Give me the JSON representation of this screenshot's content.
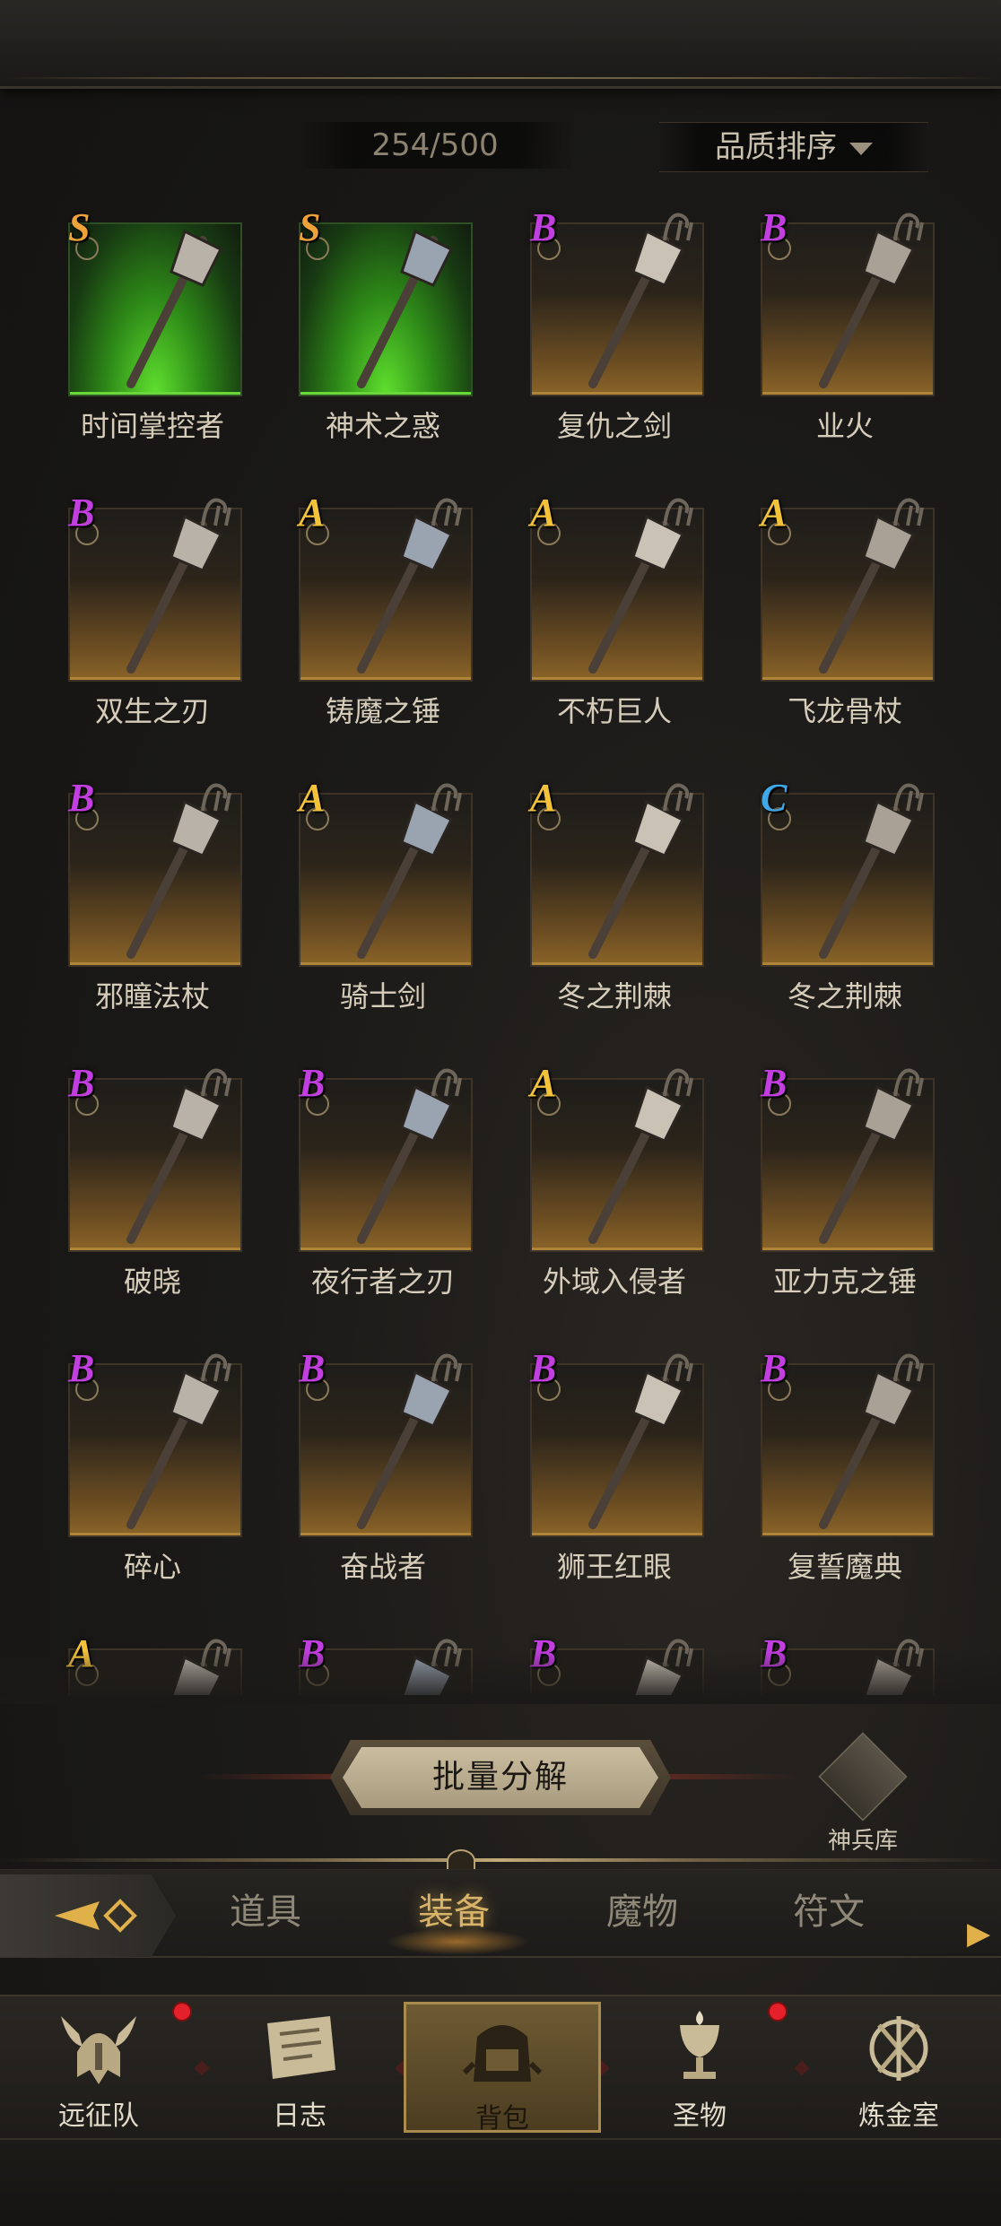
{
  "inventory": {
    "count": "254/500"
  },
  "sort": {
    "label": "品质排序"
  },
  "colors": {
    "S": "#f0a23a",
    "A": "#f2c23a",
    "B": "#c23ee0",
    "C": "#3fa8e8"
  },
  "items": [
    {
      "grade": "S",
      "name": "时间掌控者",
      "bg": "green",
      "icon": "scepter-icon"
    },
    {
      "grade": "S",
      "name": "神术之惑",
      "bg": "green",
      "icon": "star-mace-icon"
    },
    {
      "grade": "B",
      "name": "复仇之剑",
      "bg": "gold",
      "icon": "sword-icon"
    },
    {
      "grade": "B",
      "name": "业火",
      "bg": "gold",
      "icon": "fire-staff-icon"
    },
    {
      "grade": "B",
      "name": "双生之刃",
      "bg": "gold",
      "icon": "twin-blade-icon"
    },
    {
      "grade": "A",
      "name": "铸魔之锤",
      "bg": "gold",
      "icon": "hammer-icon"
    },
    {
      "grade": "A",
      "name": "不朽巨人",
      "bg": "gold",
      "icon": "great-axe-icon"
    },
    {
      "grade": "A",
      "name": "飞龙骨杖",
      "bg": "gold",
      "icon": "bone-staff-icon"
    },
    {
      "grade": "B",
      "name": "邪瞳法杖",
      "bg": "gold",
      "icon": "eye-staff-icon"
    },
    {
      "grade": "A",
      "name": "骑士剑",
      "bg": "gold",
      "icon": "knight-sword-icon"
    },
    {
      "grade": "A",
      "name": "冬之荆棘",
      "bg": "gold",
      "icon": "greatsword-icon"
    },
    {
      "grade": "C",
      "name": "冬之荆棘",
      "bg": "gold",
      "icon": "greatsword-icon"
    },
    {
      "grade": "B",
      "name": "破晓",
      "bg": "gold",
      "icon": "ornate-scepter-icon"
    },
    {
      "grade": "B",
      "name": "夜行者之刃",
      "bg": "gold",
      "icon": "dagger-icon"
    },
    {
      "grade": "A",
      "name": "外域入侵者",
      "bg": "gold",
      "icon": "axe-icon"
    },
    {
      "grade": "B",
      "name": "亚力克之锤",
      "bg": "gold",
      "icon": "warhammer-icon"
    },
    {
      "grade": "B",
      "name": "碎心",
      "bg": "gold",
      "icon": "crossbow-icon"
    },
    {
      "grade": "B",
      "name": "奋战者",
      "bg": "gold",
      "icon": "shield-axe-icon"
    },
    {
      "grade": "B",
      "name": "狮王红眼",
      "bg": "gold",
      "icon": "wand-icon"
    },
    {
      "grade": "B",
      "name": "复誓魔典",
      "bg": "gold",
      "icon": "tome-icon"
    },
    {
      "grade": "A",
      "name": "",
      "bg": "gold",
      "icon": "weapon-icon"
    },
    {
      "grade": "B",
      "name": "",
      "bg": "gold",
      "icon": "weapon-icon"
    },
    {
      "grade": "B",
      "name": "",
      "bg": "gold",
      "icon": "weapon-icon"
    },
    {
      "grade": "B",
      "name": "",
      "bg": "gold",
      "icon": "weapon-icon"
    }
  ],
  "actions": {
    "bulk_dismantle": "批量分解",
    "armory": "神兵库"
  },
  "tabs": [
    {
      "label": "道具",
      "active": false
    },
    {
      "label": "装备",
      "active": true
    },
    {
      "label": "魔物",
      "active": false
    },
    {
      "label": "符文",
      "active": false
    }
  ],
  "nav": [
    {
      "label": "远征队",
      "icon": "viking-helmet-icon",
      "badge": true,
      "active": false
    },
    {
      "label": "日志",
      "icon": "scroll-icon",
      "badge": false,
      "active": false
    },
    {
      "label": "背包",
      "icon": "backpack-icon",
      "badge": false,
      "active": true
    },
    {
      "label": "圣物",
      "icon": "chalice-icon",
      "badge": true,
      "active": false
    },
    {
      "label": "炼金室",
      "icon": "alchemy-icon",
      "badge": false,
      "active": false
    }
  ]
}
